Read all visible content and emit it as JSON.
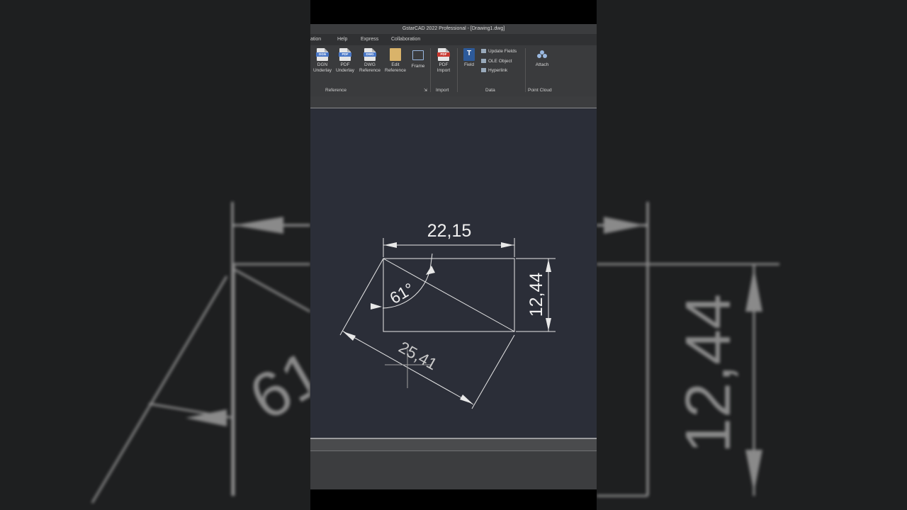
{
  "app": {
    "title": "GstarCAD 2022 Professional - [Drawing1.dwg]"
  },
  "menu": {
    "items": [
      "ation",
      "Help",
      "Express",
      "Collaboration"
    ]
  },
  "ribbon": {
    "reference_tools": [
      {
        "tag": "DGN",
        "label": "DGN\nUnderlay"
      },
      {
        "tag": "PDF",
        "label": "PDF\nUnderlay"
      },
      {
        "tag": "DWG",
        "label": "DWG\nReference"
      },
      {
        "tag": "",
        "label": "Edit\nReference"
      },
      {
        "tag": "",
        "label": "Frame"
      }
    ],
    "import_tool": {
      "tag": "PDF",
      "label": "PDF\nImport"
    },
    "field_tool": {
      "label": "Field"
    },
    "data_items": [
      "Update Fields",
      "OLE Object",
      "Hyperlink"
    ],
    "attach_tool": {
      "label": "Attach"
    },
    "panels": {
      "reference": "Reference",
      "import": "Import",
      "data": "Data",
      "point_cloud": "Point Cloud"
    }
  },
  "drawing": {
    "dim_horizontal": "22,15",
    "dim_vertical": "12,44",
    "dim_angle": "61°",
    "dim_aligned": "25,41"
  },
  "colors": {
    "canvas": "#2b2e38",
    "lines": "#e8e8e8",
    "accent": "#4a78c8"
  }
}
